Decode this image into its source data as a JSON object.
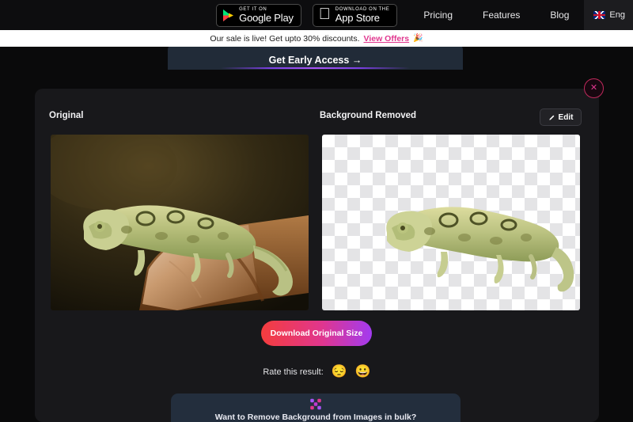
{
  "header": {
    "store_badges": [
      {
        "icon": "google-play-icon",
        "top_label": "GET IT ON",
        "main_label": "Google Play"
      },
      {
        "icon": "apple-logo-icon",
        "top_label": "Download on the",
        "main_label": "App Store"
      }
    ],
    "nav": [
      {
        "label": "Pricing"
      },
      {
        "label": "Features"
      },
      {
        "label": "Blog"
      }
    ],
    "language": {
      "label": "Eng",
      "flag": "uk-flag-icon"
    }
  },
  "announcement": {
    "text": "Our sale is live! Get upto 30% discounts.",
    "link": "View Offers",
    "emoji": "🎉"
  },
  "early_access": {
    "label": "Get Early Access →"
  },
  "main": {
    "original_label": "Original",
    "removed_label": "Background Removed",
    "edit_button": "Edit",
    "download_button": "Download Original Size",
    "rate_label": "Rate this result:",
    "rate_options": [
      {
        "name": "sad-emoji",
        "glyph": "😔"
      },
      {
        "name": "happy-emoji",
        "glyph": "😀"
      }
    ]
  },
  "bulk_banner": {
    "text": "Want to Remove Background from Images in bulk?"
  },
  "close_button": {
    "glyph": "✕"
  },
  "colors": {
    "page_bg": "#0a0a0b",
    "card_bg": "#18181b",
    "accent_pink": "#e0368e",
    "accent_purple": "#a23bf0",
    "accent_red": "#f43d3d",
    "banner_bg": "#232e3d"
  }
}
